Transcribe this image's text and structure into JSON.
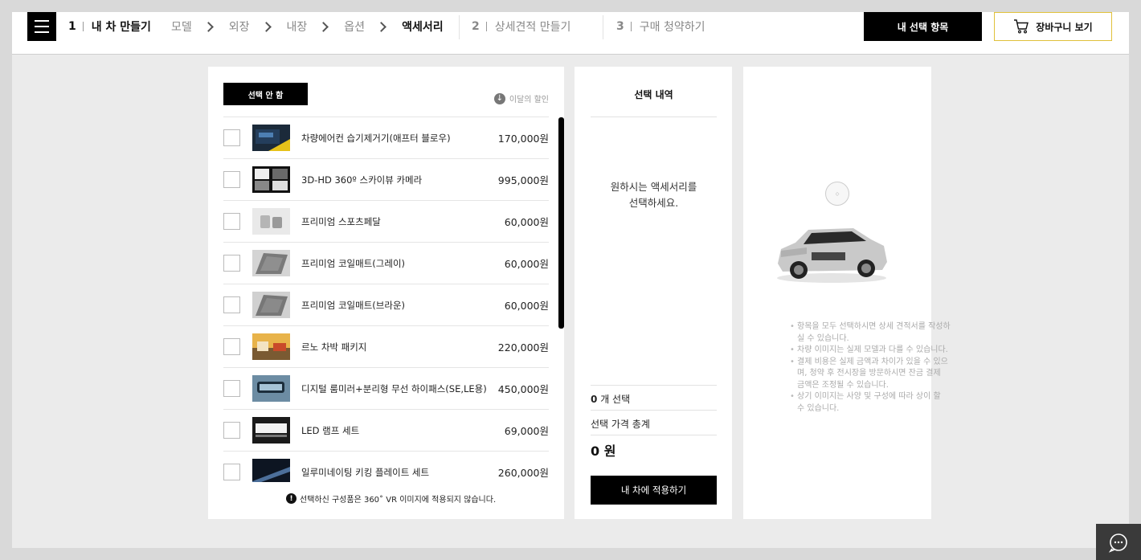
{
  "header": {
    "steps": [
      {
        "num": "1",
        "label": "내 차 만들기"
      },
      {
        "num": "2",
        "label": "상세견적 만들기"
      },
      {
        "num": "3",
        "label": "구매 청약하기"
      }
    ],
    "substeps": [
      {
        "label": "모델"
      },
      {
        "label": "외장"
      },
      {
        "label": "내장"
      },
      {
        "label": "옵션"
      },
      {
        "label": "액세서리"
      }
    ],
    "my_selection_label": "내 선택 항목",
    "cart_label": "장바구니 보기"
  },
  "accessories": {
    "none_label": "선택 안 함",
    "discount_label": "이달의 할인",
    "items": [
      {
        "name": "차량에어컨 습기제거기(애프터 블로우)",
        "price": "170,000원",
        "thumb": "air-dryer"
      },
      {
        "name": "3D-HD 360º 스카이뷰 카메라",
        "price": "995,000원",
        "thumb": "camera"
      },
      {
        "name": "프리미엄 스포츠페달",
        "price": "60,000원",
        "thumb": "pedal"
      },
      {
        "name": "프리미엄 코일매트(그레이)",
        "price": "60,000원",
        "thumb": "mat-gray"
      },
      {
        "name": "프리미엄 코일매트(브라운)",
        "price": "60,000원",
        "thumb": "mat-brown"
      },
      {
        "name": "르노 차박 패키지",
        "price": "220,000원",
        "thumb": "camping"
      },
      {
        "name": "디지털 룸미러+분리형 무선 하이패스(SE,LE용)",
        "price": "450,000원",
        "thumb": "mirror"
      },
      {
        "name": "LED 램프 세트",
        "price": "69,000원",
        "thumb": "led"
      },
      {
        "name": "일루미네이팅 키킹 플레이트 세트",
        "price": "260,000원",
        "thumb": "plate"
      }
    ],
    "notice": "선택하신 구성품은 360˚ VR 이미지에 적용되지 않습니다."
  },
  "selection": {
    "title": "선택 내역",
    "placeholder_line1": "원하시는 액세서리를",
    "placeholder_line2": "선택하세요.",
    "count": "0",
    "count_suffix": "개 선택",
    "total_label": "선택 가격 총계",
    "total_value": "0 원",
    "apply_label": "내 차에 적용하기"
  },
  "preview": {
    "notes": [
      "항목을 모두 선택하시면 상세 견적서를 작성하실 수 있습니다.",
      "차량 이미지는 실제 모델과 다를 수 있습니다.",
      "결제 비용은 실제 금액과 차이가 있을 수 있으며, 청약 후 전시장을 방문하시면 잔금 결제 금액은 조정될 수 있습니다.",
      "상기 이미지는 사양 및 구성에 따라 상이 할 수 있습니다."
    ]
  }
}
